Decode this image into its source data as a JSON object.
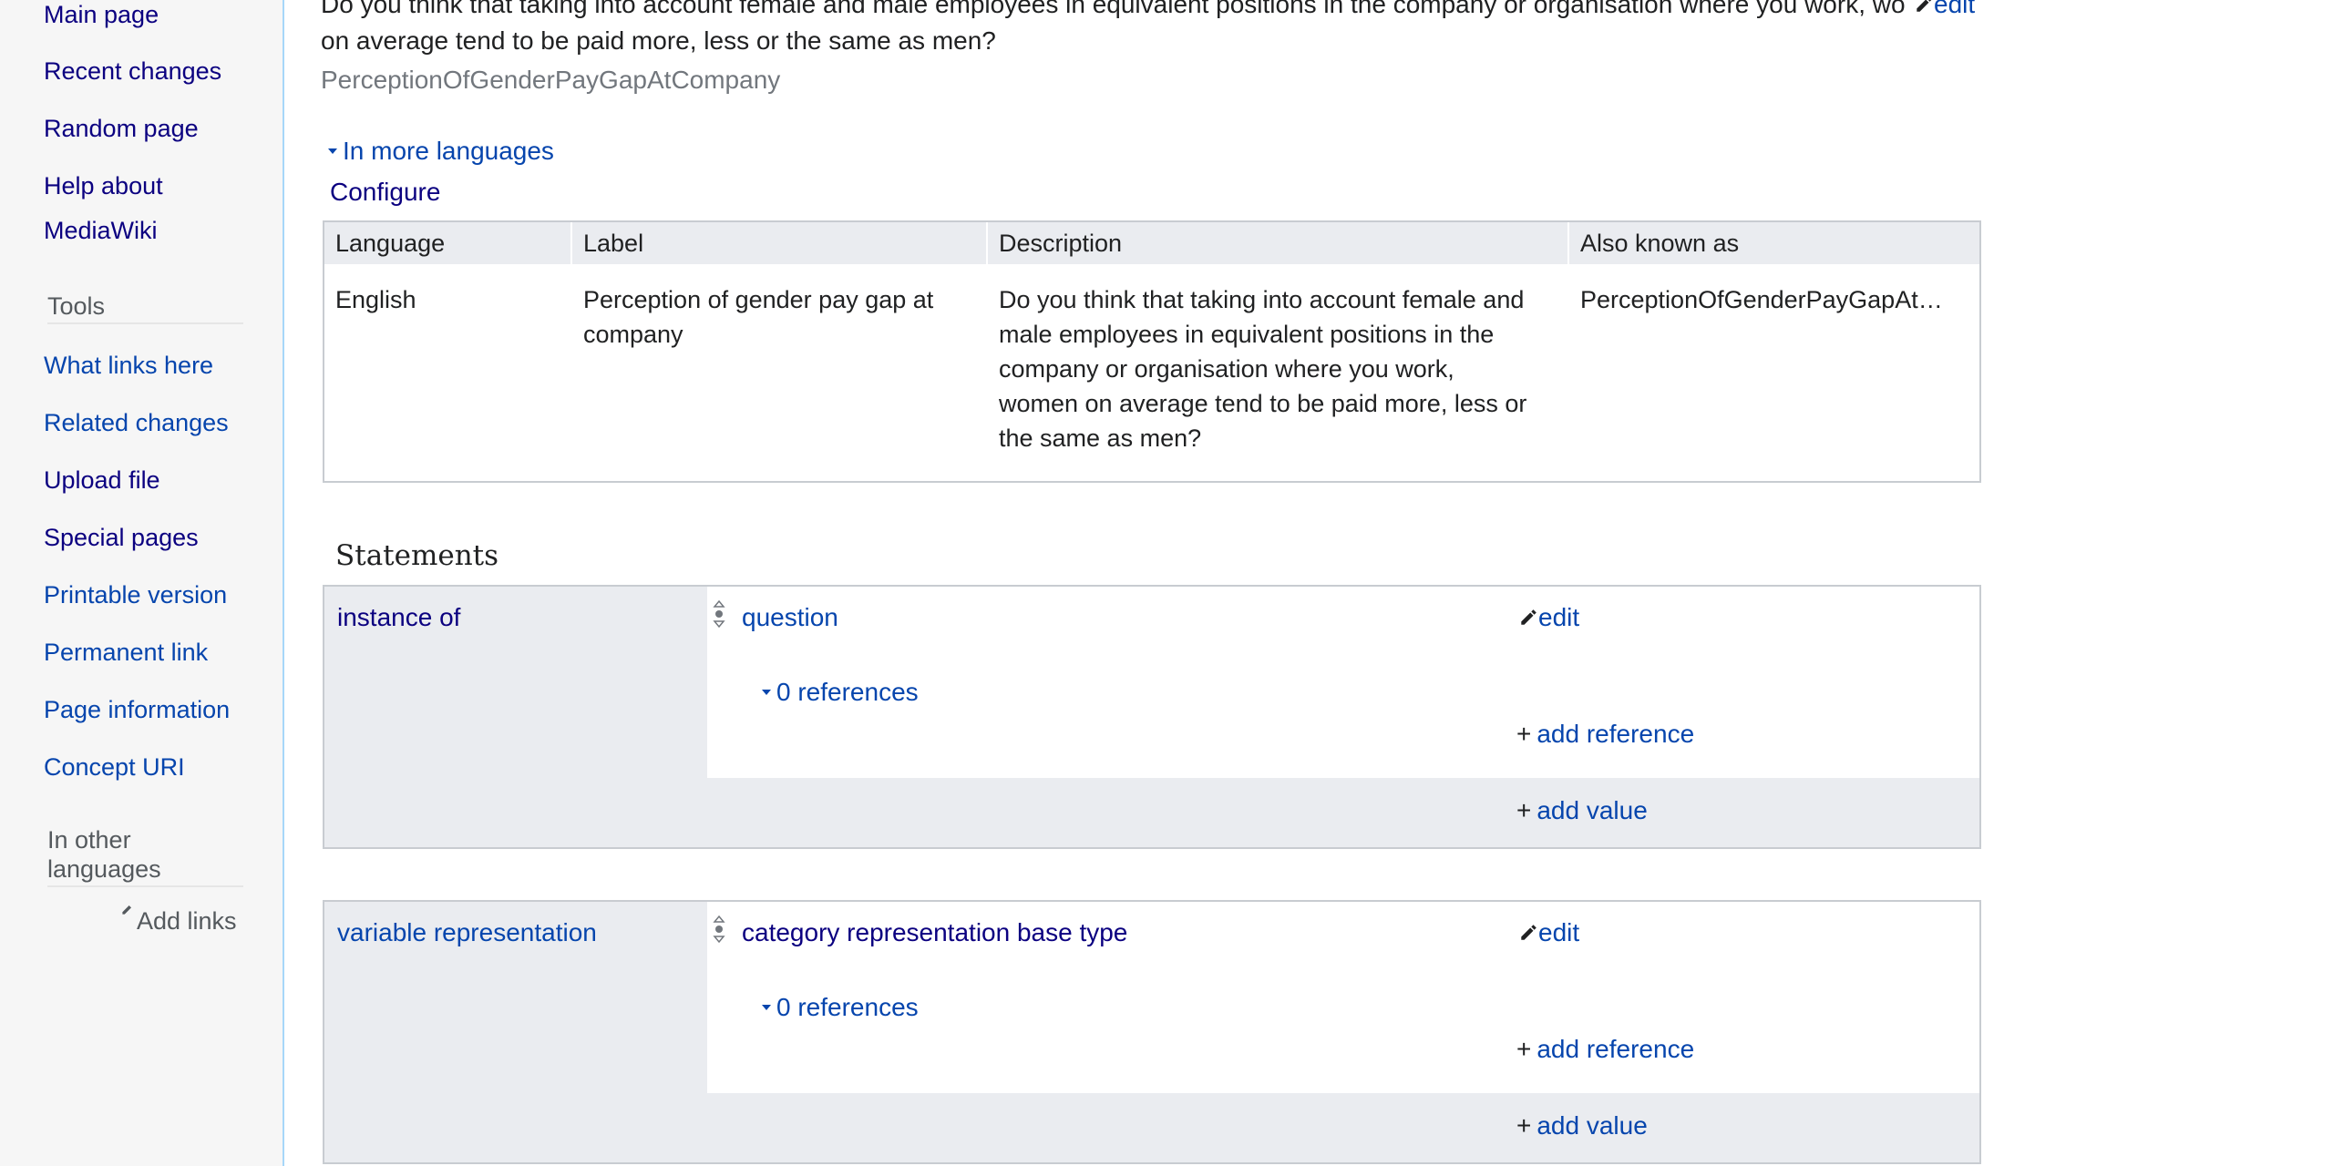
{
  "sidebar": {
    "nav": [
      {
        "label": "Main page"
      },
      {
        "label": "Recent changes"
      },
      {
        "label": "Random page"
      },
      {
        "label": "Help about"
      },
      {
        "label": "MediaWiki"
      }
    ],
    "tools_heading": "Tools",
    "tools": [
      {
        "label": "What links here"
      },
      {
        "label": "Related changes"
      },
      {
        "label": "Upload file"
      },
      {
        "label": "Special pages"
      },
      {
        "label": "Printable version"
      },
      {
        "label": "Permanent link"
      },
      {
        "label": "Page information"
      },
      {
        "label": "Concept URI"
      }
    ],
    "languages_heading_1": "In other",
    "languages_heading_2": "languages",
    "add_links": "Add links"
  },
  "header": {
    "description_line1": "Do you think that taking into account female and male employees in equivalent positions in the company or organisation where you work, wor",
    "edit_label": "edit",
    "description_line2": "on average tend to be paid more, less or the same as men?",
    "alias": "PerceptionOfGenderPayGapAtCompany",
    "more_languages": "In more languages",
    "configure": "Configure"
  },
  "terms": {
    "columns": [
      "Language",
      "Label",
      "Description",
      "Also known as"
    ],
    "row": {
      "language": "English",
      "label_l1": "Perception of gender pay gap at",
      "label_l2": "company",
      "desc_l1": "Do you think that taking into account female and",
      "desc_l2": "male employees in equivalent positions in the",
      "desc_l3": "company or organisation where you work,",
      "desc_l4": "women on average tend to be paid more, less or",
      "desc_l5": "the same as men?",
      "aliases": "PerceptionOfGenderPayGapAt…"
    }
  },
  "statements": {
    "heading": "Statements",
    "items": [
      {
        "property": "instance of",
        "value": "question",
        "edit": "edit",
        "references": "0 references",
        "add_reference": "add reference",
        "add_value": "add value"
      },
      {
        "property": "variable representation",
        "value": "category representation base type",
        "edit": "edit",
        "references": "0 references",
        "add_reference": "add reference",
        "add_value": "add value"
      }
    ]
  },
  "colors": {
    "link": "#0645ad",
    "visited": "#0b0080",
    "header_bg": "#eaecf0",
    "border": "#c8ccd1",
    "sidebar_bg": "#f6f6f6"
  }
}
